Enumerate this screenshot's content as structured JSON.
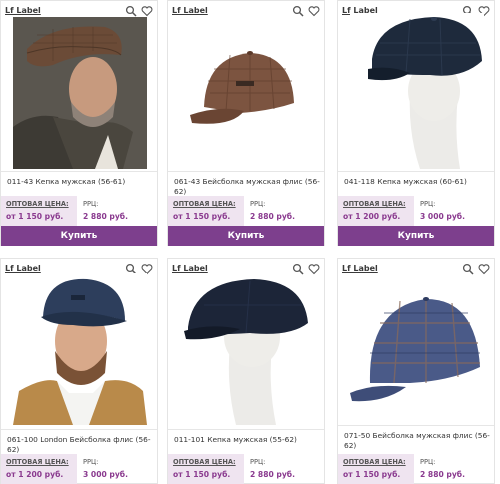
{
  "products": [
    {
      "brand": "Lf Label",
      "name": "011-43 Кепка мужская (56-61)",
      "opt_label": "ОПТОВАЯ ЦЕНА:",
      "opt_price": "от 1 150 руб.",
      "rrc_label": "РРЦ:",
      "rrc_price": "2 880 руб.",
      "buy": "Купить"
    },
    {
      "brand": "Lf Label",
      "name": "061-43 Бейсболка мужская флис (56-62)",
      "opt_label": "ОПТОВАЯ ЦЕНА:",
      "opt_price": "от 1 150 руб.",
      "rrc_label": "РРЦ:",
      "rrc_price": "2 880 руб.",
      "buy": "Купить"
    },
    {
      "brand": "Lf Label",
      "name": "041-118 Кепка мужская (60-61)",
      "opt_label": "ОПТОВАЯ ЦЕНА:",
      "opt_price": "от 1 200 руб.",
      "rrc_label": "РРЦ:",
      "rrc_price": "3 000 руб.",
      "buy": "Купить"
    },
    {
      "brand": "Lf Label",
      "name": "061-100 London Бейсболка флис (56-62)",
      "opt_label": "ОПТОВАЯ ЦЕНА:",
      "opt_price": "от 1 200 руб.",
      "rrc_label": "РРЦ:",
      "rrc_price": "3 000 руб."
    },
    {
      "brand": "Lf Label",
      "name": "011-101 Кепка мужская (55-62)",
      "opt_label": "ОПТОВАЯ ЦЕНА:",
      "opt_price": "от 1 150 руб.",
      "rrc_label": "РРЦ:",
      "rrc_price": "2 880 руб."
    },
    {
      "brand": "Lf Label",
      "name": "071-50 Бейсболка мужская флис (56-62)",
      "opt_label": "ОПТОВАЯ ЦЕНА:",
      "opt_price": "от 1 150 руб.",
      "rrc_label": "РРЦ:",
      "rrc_price": "2 880 руб."
    }
  ],
  "icons": {
    "search": "search-icon",
    "favorite": "heart-icon"
  },
  "colors": {
    "accent": "#7d3f8d",
    "price": "#8a3a8f",
    "opt_bg": "#efe4f0"
  }
}
